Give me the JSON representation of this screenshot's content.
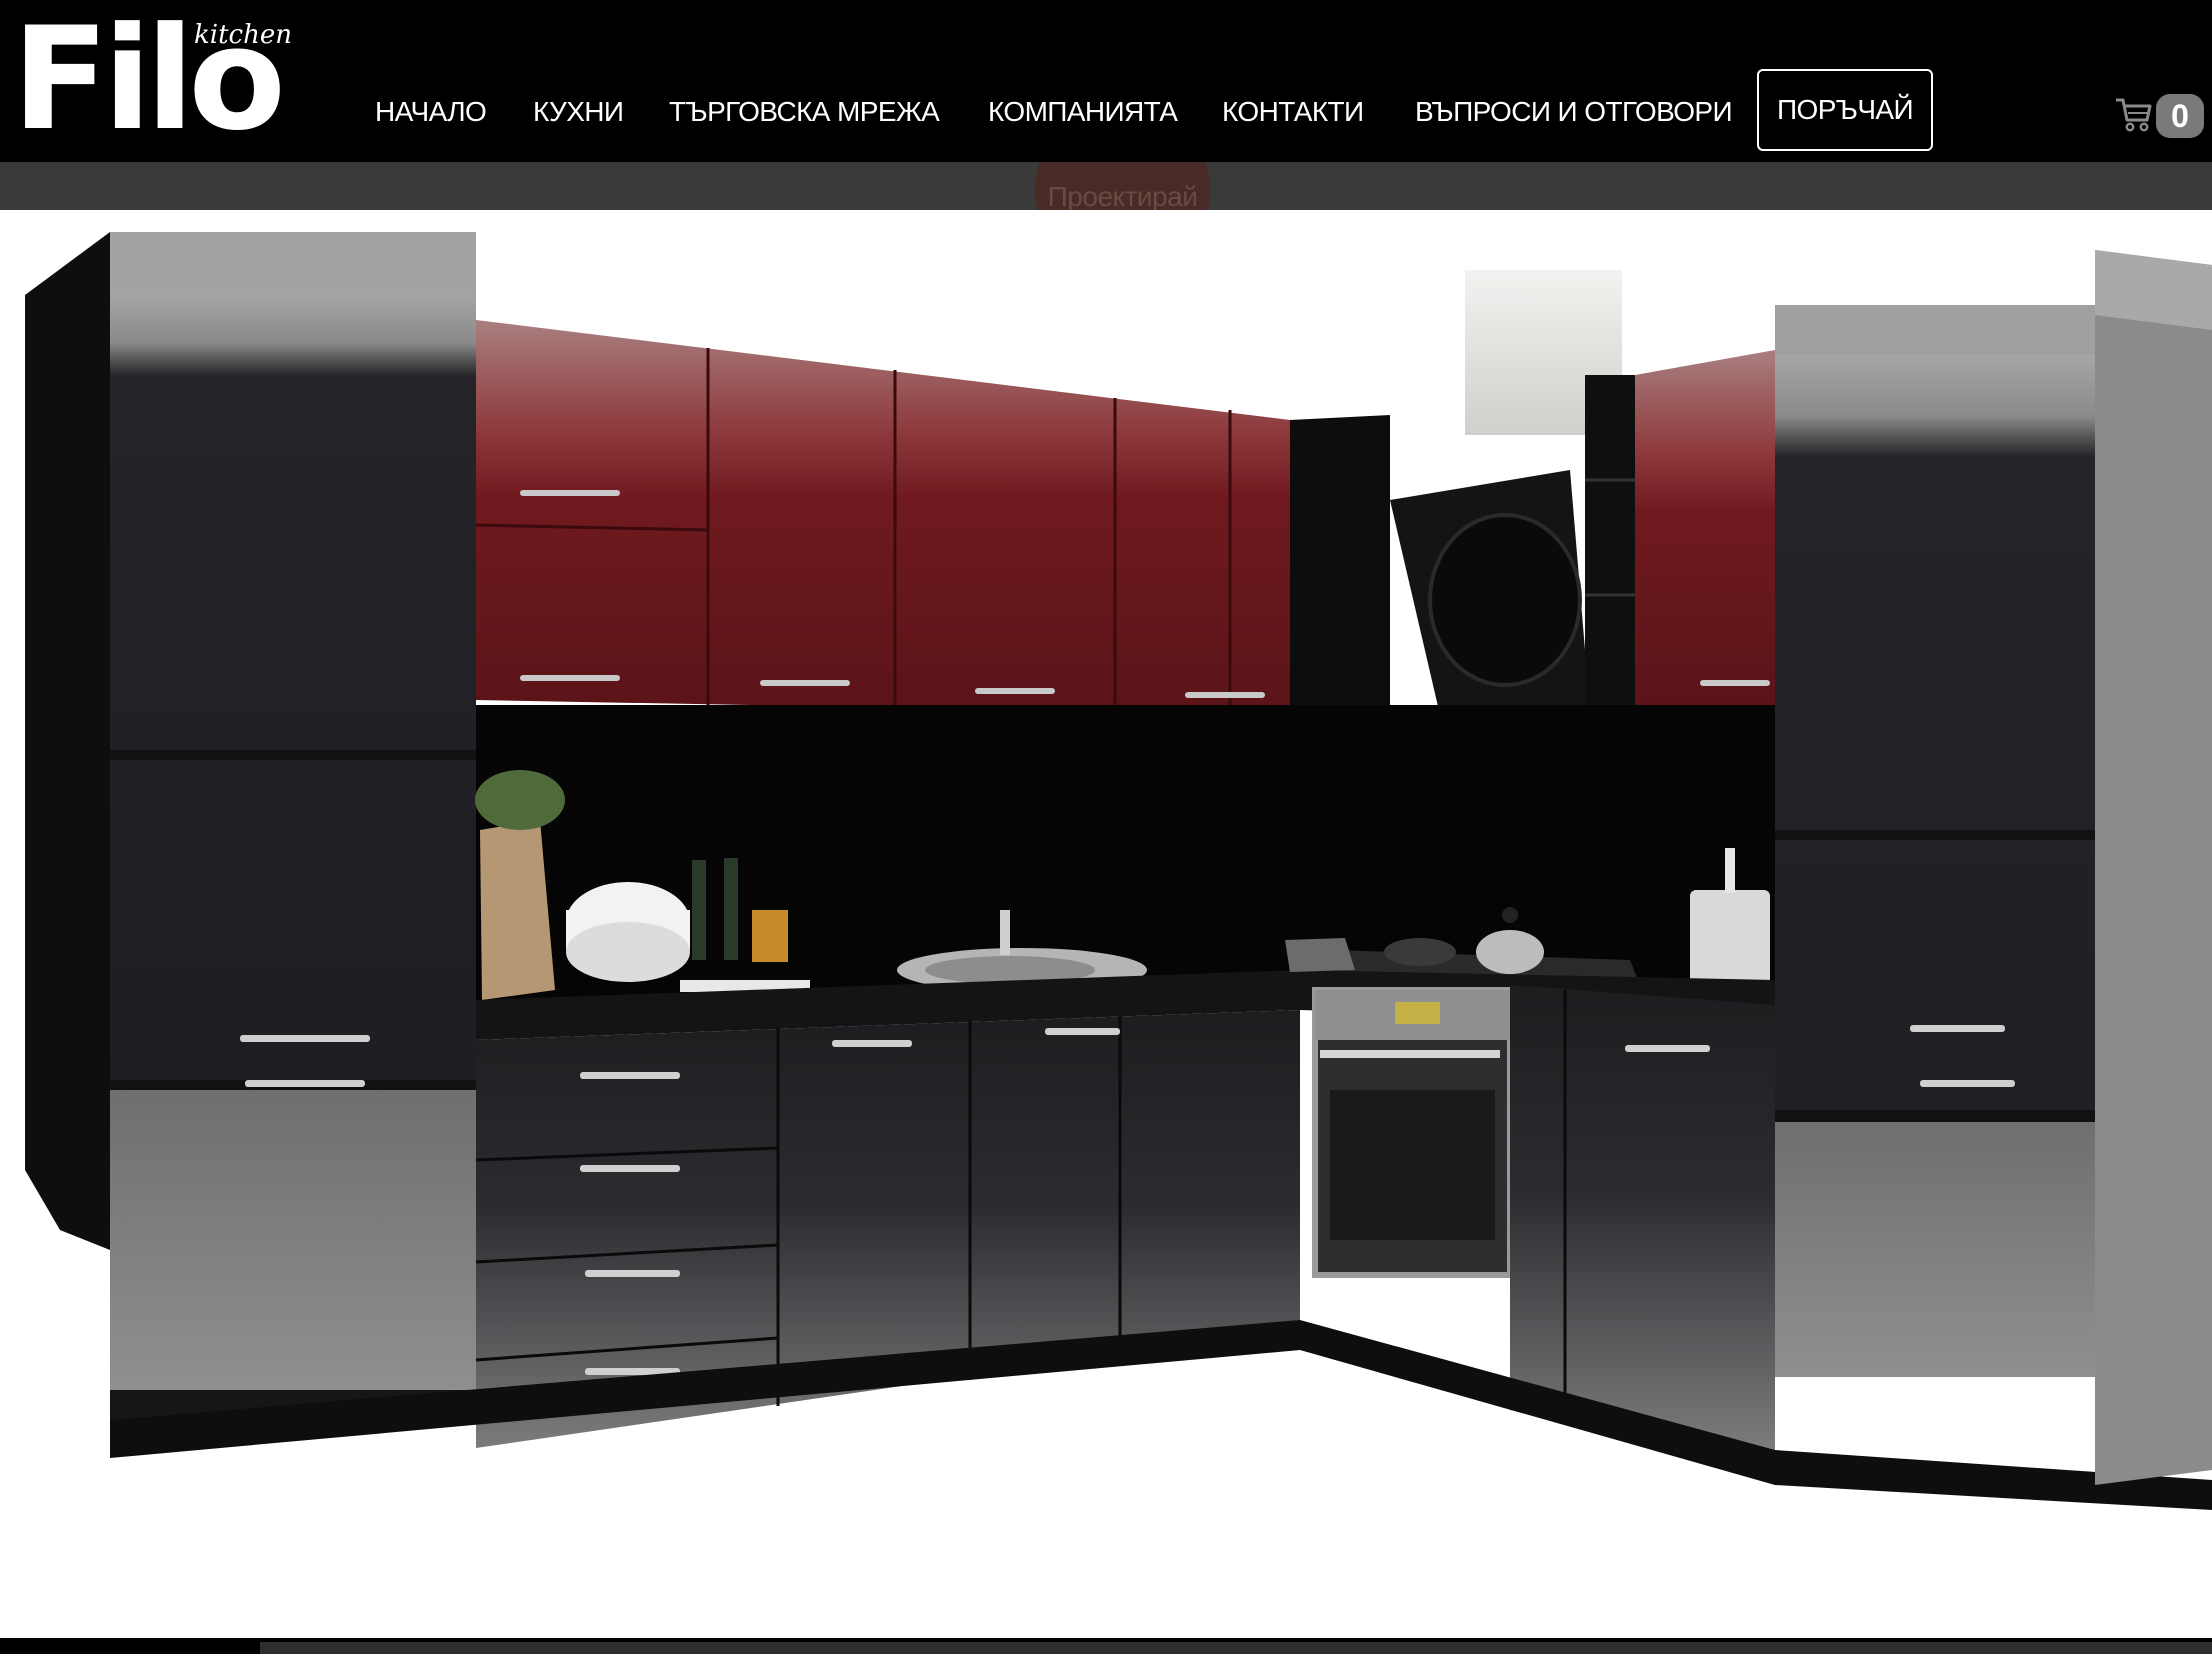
{
  "brand": {
    "name": "Filo",
    "tagline": "kitchen"
  },
  "nav": {
    "items": [
      {
        "label": "НАЧАЛО"
      },
      {
        "label": "КУХНИ"
      },
      {
        "label": "ТЪРГОВСКА МРЕЖА"
      },
      {
        "label": "КОМПАНИЯТА"
      },
      {
        "label": "КОНТАКТИ"
      },
      {
        "label": "ВЪПРОСИ И ОТГОВОРИ"
      }
    ],
    "order_label": "ПОРЪЧАЙ"
  },
  "cart": {
    "icon": "cart-icon",
    "count": "0"
  },
  "subbar": {
    "design_label": "Проектирай"
  },
  "colors": {
    "header_bg": "#000000",
    "subbar_bg": "#3a3a3a",
    "cabinet_red": "#7a1d22",
    "cabinet_black": "#1f1f22",
    "cabinet_grey": "#8a8a8a",
    "cart_badge": "#7a7a7a"
  }
}
